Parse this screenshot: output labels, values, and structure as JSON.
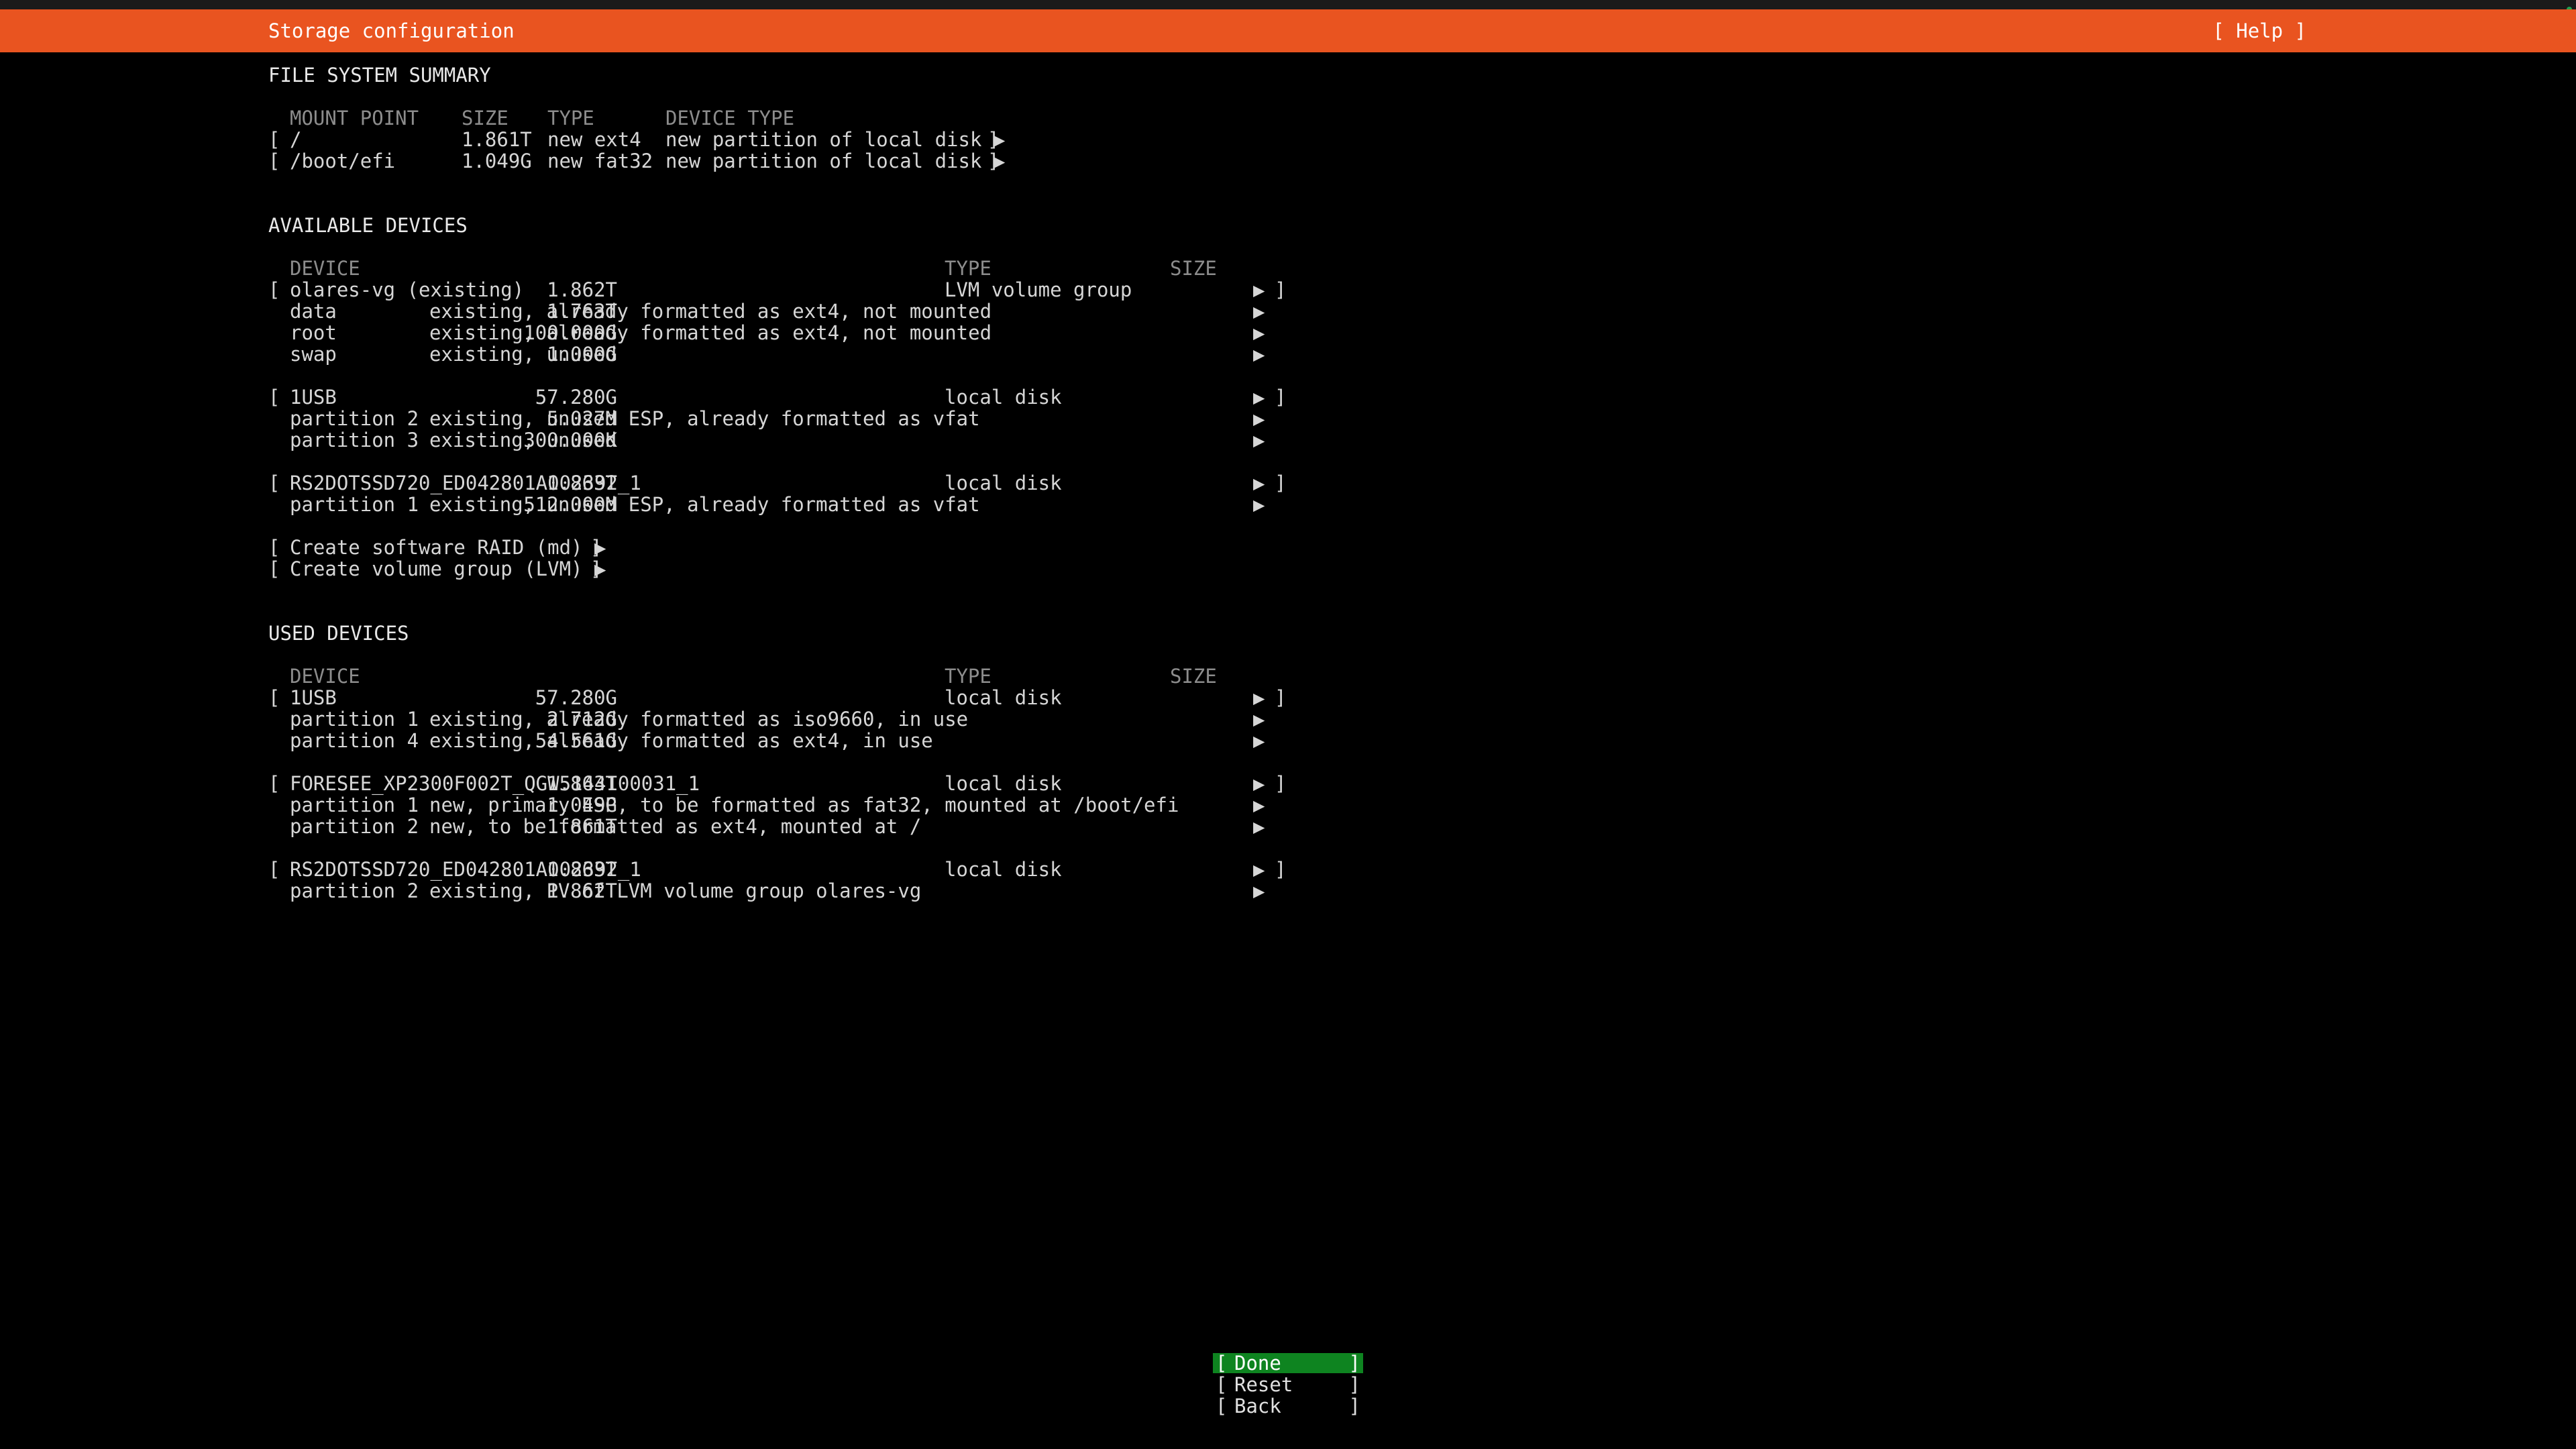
{
  "header": {
    "title": "Storage configuration",
    "help": "[ Help ]"
  },
  "fs_summary": {
    "heading": "FILE SYSTEM SUMMARY",
    "columns": [
      "MOUNT POINT",
      "SIZE",
      "TYPE",
      "DEVICE TYPE"
    ],
    "rows": [
      {
        "mount": "/",
        "size": "1.861T",
        "type": "new ext4",
        "device_type": "new partition of local disk ▶"
      },
      {
        "mount": "/boot/efi",
        "size": "1.049G",
        "type": "new fat32",
        "device_type": "new partition of local disk ▶"
      }
    ]
  },
  "available": {
    "heading": "AVAILABLE DEVICES",
    "columns": {
      "device": "DEVICE",
      "type": "TYPE",
      "size": "SIZE"
    },
    "vg": {
      "name": "olares-vg (existing)",
      "type": "LVM volume group",
      "size": "1.862T"
    },
    "vg_lvs": [
      {
        "name": "data",
        "desc": "existing, already formatted as ext4, not mounted",
        "size": "1.763T"
      },
      {
        "name": "root",
        "desc": "existing, already formatted as ext4, not mounted",
        "size": "100.000G"
      },
      {
        "name": "swap",
        "desc": "existing, unused",
        "size": "1.000G"
      }
    ],
    "usb": {
      "name": "1USB",
      "type": "local disk",
      "size": "57.280G"
    },
    "usb_parts": [
      {
        "name": "partition 2",
        "desc": "existing, unused ESP, already formatted as vfat",
        "size": "5.027M"
      },
      {
        "name": "partition 3",
        "desc": "existing, unused",
        "size": "300.000K"
      }
    ],
    "rs": {
      "name": "RS2DOTSSD720_ED042801A002392_1",
      "type": "local disk",
      "size": "1.863T"
    },
    "rs_parts": [
      {
        "name": "partition 1",
        "desc": "existing, unused ESP, already formatted as vfat",
        "size": "512.000M"
      }
    ],
    "actions": [
      "Create software RAID (md) ▶",
      "Create volume group (LVM) ▶"
    ]
  },
  "used": {
    "heading": "USED DEVICES",
    "columns": {
      "device": "DEVICE",
      "type": "TYPE",
      "size": "SIZE"
    },
    "usb": {
      "name": "1USB",
      "type": "local disk",
      "size": "57.280G"
    },
    "usb_parts": [
      {
        "name": "partition 1",
        "desc": "existing, already formatted as iso9660, in use",
        "size": "2.712G"
      },
      {
        "name": "partition 4",
        "desc": "existing, already formatted as ext4, in use",
        "size": "54.561G"
      }
    ],
    "foresee": {
      "name": "FORESEE_XP2300F002T_QGW5144100031_1",
      "type": "local disk",
      "size": "1.863T"
    },
    "foresee_parts": [
      {
        "name": "partition 1",
        "desc": "new, primary ESP, to be formatted as fat32, mounted at /boot/efi",
        "size": "1.049G"
      },
      {
        "name": "partition 2",
        "desc": "new, to be formatted as ext4, mounted at /",
        "size": "1.861T"
      }
    ],
    "rs": {
      "name": "RS2DOTSSD720_ED042801A002392_1",
      "type": "local disk",
      "size": "1.863T"
    },
    "rs_parts": [
      {
        "name": "partition 2",
        "desc": "existing, PV of LVM volume group olares-vg",
        "size": "1.862T"
      }
    ]
  },
  "symbols": {
    "arrow": "▶",
    "open": "[",
    "close": "]"
  },
  "buttons": {
    "done": "Done",
    "reset": "Reset",
    "back": "Back"
  },
  "colors": {
    "titlebar": "#e95420",
    "active_button": "#0e8420",
    "background": "#000000"
  }
}
